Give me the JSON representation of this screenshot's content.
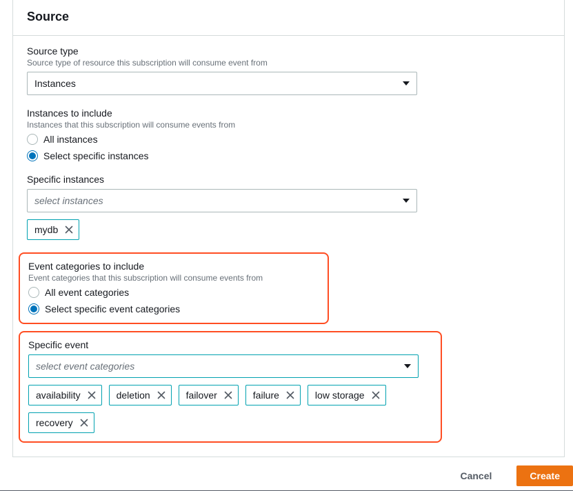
{
  "panel": {
    "title": "Source"
  },
  "sourceType": {
    "label": "Source type",
    "hint": "Source type of resource this subscription will consume event from",
    "value": "Instances"
  },
  "instancesInclude": {
    "label": "Instances to include",
    "hint": "Instances that this subscription will consume events from",
    "options": {
      "all": "All instances",
      "specific": "Select specific instances"
    },
    "selected": "specific"
  },
  "specificInstances": {
    "label": "Specific instances",
    "placeholder": "select instances",
    "tags": [
      "mydb"
    ]
  },
  "eventCategoriesInclude": {
    "label": "Event categories to include",
    "hint": "Event categories that this subscription will consume events from",
    "options": {
      "all": "All event categories",
      "specific": "Select specific event categories"
    },
    "selected": "specific"
  },
  "specificEvent": {
    "label": "Specific event",
    "placeholder": "select event categories",
    "tags": [
      "availability",
      "deletion",
      "failover",
      "failure",
      "low storage",
      "recovery"
    ]
  },
  "footer": {
    "cancel": "Cancel",
    "create": "Create"
  }
}
